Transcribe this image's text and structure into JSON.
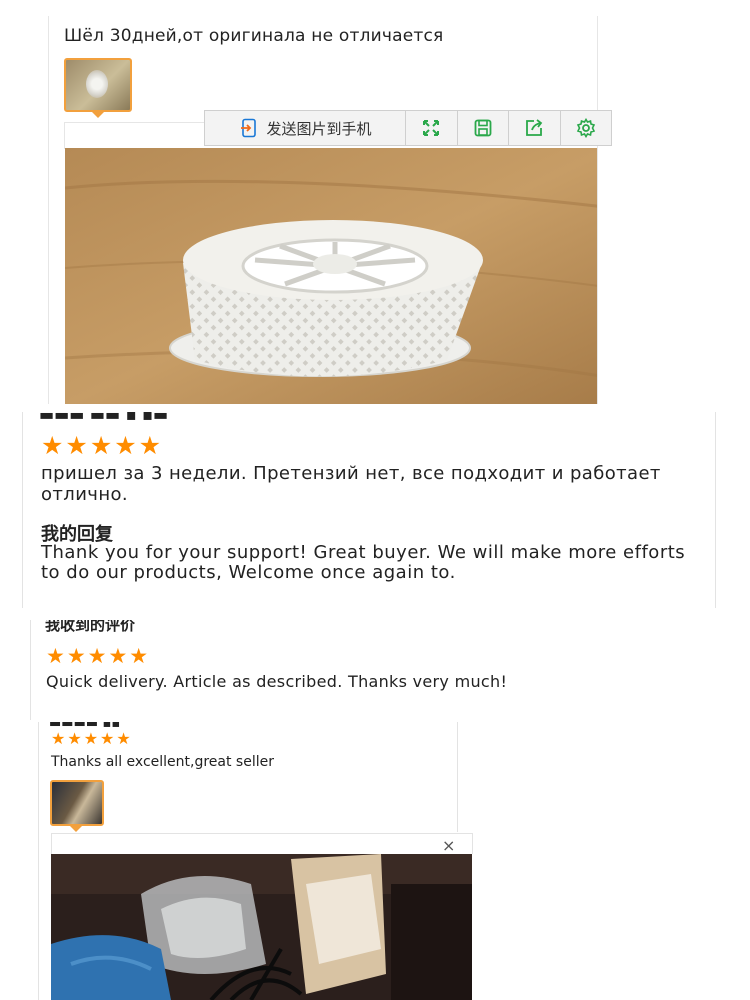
{
  "review1": {
    "text": "Шёл 30дней,от оригинала не отличается",
    "thumbnail_icon": "photo-thumbnail"
  },
  "toolbar": {
    "send_label": "发送图片到手机",
    "icons": [
      "send-to-phone-icon",
      "fullscreen-icon",
      "save-icon",
      "share-icon",
      "settings-icon"
    ],
    "accent": "#2aa84a"
  },
  "review2": {
    "stars": "★★★★★",
    "text": "пришел за 3 недели. Претензий нет, все подходит и работает отлично.",
    "reply_title": "我的回复",
    "reply": "Thank you for your support! Great buyer. We will make more efforts to do our products, Welcome once again to."
  },
  "review3": {
    "header_fragment": "我收到的评价",
    "stars": "★★★★★",
    "text": "Quick delivery. Article as described. Thanks very much!"
  },
  "review4": {
    "stars": "★★★★★",
    "text": "Thanks all excellent,great seller",
    "close_glyph": "×"
  },
  "colors": {
    "star": "#ff8c00",
    "thumb_border": "#f2a03d",
    "border": "#e3e3e3"
  }
}
